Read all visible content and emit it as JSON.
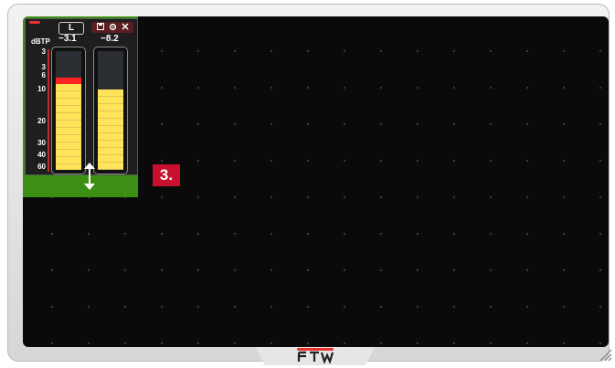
{
  "widget": {
    "unit_label": "dBTP",
    "channel_label": "L",
    "left_value": "−3.1",
    "right_value": "−8.2",
    "scale_ticks": [
      "3",
      "3",
      "6",
      "10",
      "20",
      "30",
      "40",
      "60"
    ],
    "toolbar_icons": [
      "save-icon",
      "settings-icon",
      "close-icon"
    ],
    "left_level_fraction": 0.72,
    "right_level_fraction": 0.68
  },
  "annotation": {
    "step_label": "3."
  },
  "brand": {
    "logo_text": "RTW"
  },
  "colors": {
    "widget_background": "#3d8f14",
    "meter_fill": "#ffe45a",
    "peak": "#ff2222",
    "badge": "#c8102e",
    "screen": "#0a0a0a"
  }
}
